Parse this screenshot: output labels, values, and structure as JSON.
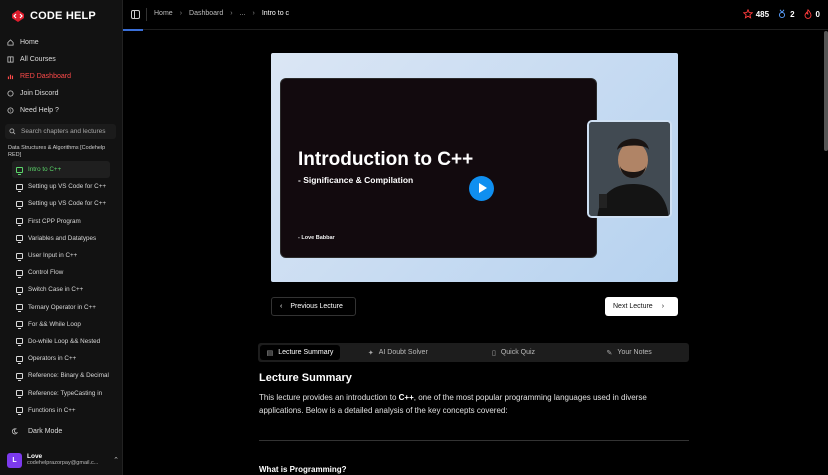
{
  "brand": {
    "name": "CODE HELP",
    "accent": "#e11d2e"
  },
  "sidebar": {
    "nav": [
      {
        "label": "Home",
        "icon": "home-icon"
      },
      {
        "label": "All Courses",
        "icon": "book-icon"
      },
      {
        "label": "RED Dashboard",
        "icon": "bar-chart-icon",
        "color": "#ff4a4a"
      },
      {
        "label": "Join Discord",
        "icon": "discord-icon"
      },
      {
        "label": "Need Help ?",
        "icon": "help-icon"
      }
    ],
    "search_placeholder": "Search chapters and lectures",
    "course_title": "Data Structures & Algorithms [Codehelp RED]",
    "lessons": [
      "Intro to C++",
      "Setting up VS Code for C++",
      "Setting up VS Code for C++",
      "First CPP Program",
      "Variables and Datatypes",
      "User Input in C++",
      "Control Flow",
      "Switch Case in C++",
      "Ternary Operator in C++",
      "For && While Loop",
      "Do-while Loop && Nested",
      "Operators in C++",
      "Reference: Binary & Decimal",
      "Reference: TypeCasting in",
      "Functions in C++"
    ],
    "dark_mode_label": "Dark Mode",
    "user": {
      "initial": "L",
      "name": "Love",
      "email": "codehelprazorpay@gmail.c..."
    }
  },
  "header": {
    "breadcrumb": {
      "home": "Home",
      "dashboard": "Dashboard",
      "ellipsis": "...",
      "current": "Intro to c"
    },
    "stats": {
      "stars": "485",
      "rank": "2",
      "streak": "0"
    }
  },
  "video": {
    "title": "Introduction to C++",
    "subtitle": "- Significance & Compilation",
    "author": "- Love Babbar"
  },
  "nav_buttons": {
    "prev": "Previous Lecture",
    "next": "Next Lecture"
  },
  "tabs": [
    "Lecture Summary",
    "AI Doubt Solver",
    "Quick Quiz",
    "Your Notes"
  ],
  "content": {
    "heading": "Lecture Summary",
    "para_start": "This lecture provides an introduction to ",
    "para_bold": "C++",
    "para_end": ", one of the most popular programming languages used in diverse applications. Below is a detailed analysis of the key concepts covered:",
    "section_heading": "What is Programming?"
  }
}
